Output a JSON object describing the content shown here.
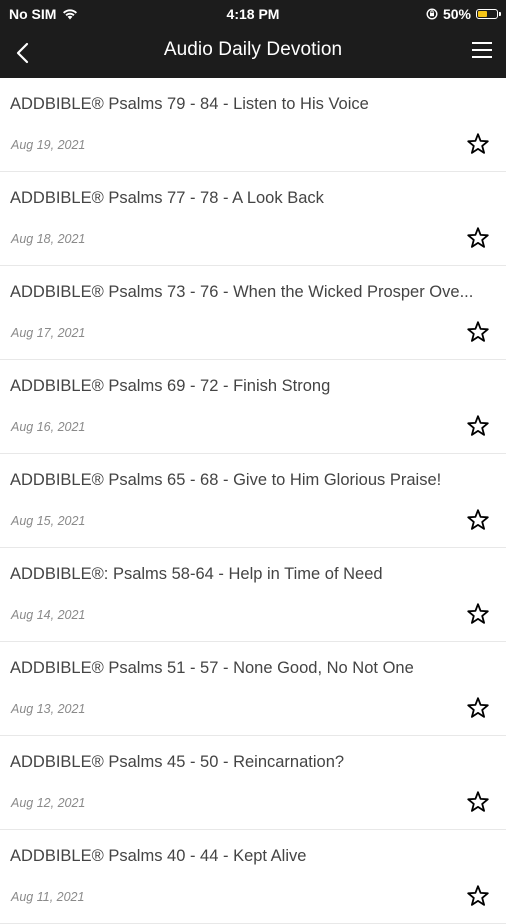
{
  "status_bar": {
    "carrier": "No SIM",
    "time": "4:18 PM",
    "battery": "50%",
    "battery_level": 0.5,
    "battery_color": "#f5c518"
  },
  "nav": {
    "title": "Audio Daily Devotion",
    "back_icon": "chevron-left-icon",
    "menu_icon": "hamburger-menu-icon"
  },
  "items": [
    {
      "title": "ADDBIBLE® Psalms 79 - 84 - Listen to His Voice",
      "date": "Aug 19, 2021"
    },
    {
      "title": "ADDBIBLE® Psalms 77 - 78 - A Look Back",
      "date": "Aug 18, 2021"
    },
    {
      "title": "ADDBIBLE® Psalms 73 - 76 - When the Wicked Prosper Ove...",
      "date": "Aug 17, 2021"
    },
    {
      "title": "ADDBIBLE® Psalms 69 - 72 - Finish Strong",
      "date": "Aug 16, 2021"
    },
    {
      "title": "ADDBIBLE® Psalms 65 - 68 - Give to Him Glorious Praise!",
      "date": "Aug 15, 2021"
    },
    {
      "title": "ADDBIBLE®: Psalms 58-64 - Help in Time of Need",
      "date": "Aug 14, 2021"
    },
    {
      "title": "ADDBIBLE® Psalms 51 - 57 - None Good, No Not One",
      "date": "Aug 13, 2021"
    },
    {
      "title": "ADDBIBLE® Psalms 45 - 50 - Reincarnation?",
      "date": "Aug 12, 2021"
    },
    {
      "title": "ADDBIBLE® Psalms 40 - 44 - Kept Alive",
      "date": "Aug 11, 2021"
    }
  ]
}
